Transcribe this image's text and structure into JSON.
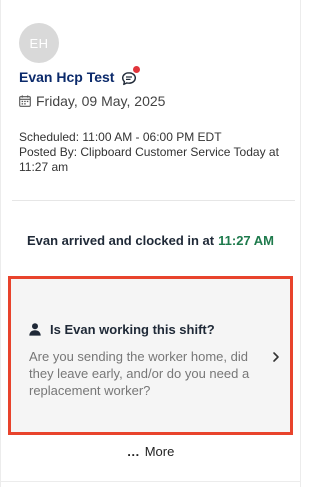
{
  "worker": {
    "initials": "EH",
    "name": "Evan Hcp Test",
    "has_unread_indicator": true
  },
  "shift": {
    "date": "Friday, 09 May, 2025",
    "scheduled": "Scheduled: 11:00 AM - 06:00 PM EDT",
    "posted_by": "Posted By: Clipboard Customer Service Today at 11:27 am"
  },
  "arrival": {
    "message": "Evan arrived and clocked in at",
    "time": "11:27 AM"
  },
  "prompt": {
    "title": "Is Evan working this shift?",
    "description": "Are you sending the worker home, did they leave early, and/or do you need a replacement worker?"
  },
  "more": {
    "label": "More",
    "icon_glyph": "…"
  },
  "colors": {
    "name": "#0b2a6b",
    "clock_time": "#1e7a4c",
    "highlight_border": "#e8432c",
    "notification_dot": "#e1343b"
  },
  "icons": [
    "chat-bubble-icon",
    "calendar-icon",
    "person-icon",
    "chevron-right-icon",
    "ellipsis-icon"
  ]
}
